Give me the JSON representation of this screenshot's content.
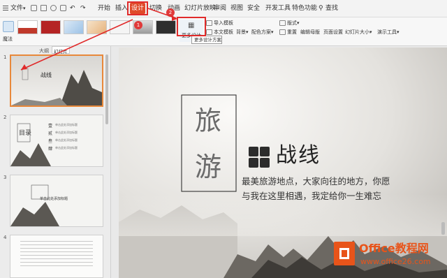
{
  "menubar": {
    "file_label": "文件",
    "tabs": [
      "开始",
      "插入",
      "设计",
      "切换",
      "动画",
      "幻灯片放映",
      "审阅",
      "视图",
      "安全",
      "开发工具",
      "特色功能"
    ],
    "search_label": "查找"
  },
  "ribbon": {
    "magic_label": "魔法",
    "more_designs_label": "更多设计",
    "import_template_label": "导入模板",
    "this_doc_template_label": "本文模板",
    "background_label": "背景",
    "color_scheme_label": "配色方案",
    "layout_label": "版式",
    "reset_label": "重置",
    "edit_master_label": "编辑母版",
    "page_setup_label": "页面设置",
    "slide_size_label": "幻灯片大小",
    "presentation_tools_label": "演示工具",
    "tooltip": "更多设计方案"
  },
  "sidepanel": {
    "tab_outline": "大纲",
    "tab_slides": "幻灯片",
    "slides": [
      {
        "num": "1",
        "title": "战线"
      },
      {
        "num": "2",
        "title": "目录"
      },
      {
        "num": "3",
        "title": "单击此处添加标题"
      },
      {
        "num": "4",
        "title": ""
      }
    ],
    "slide2_items": [
      "壹",
      "贰",
      "叁",
      "肆"
    ],
    "slide2_item_text": "单击此处添加标题"
  },
  "slide": {
    "big_title_top": "旅",
    "big_title_bottom": "游",
    "headline": "战线",
    "line1": "最美旅游地点，大家向往的地方，你愿",
    "line2": "与我在这里相遇，我定给你一生难忘"
  },
  "callouts": {
    "badge1": "1",
    "badge2": "2"
  },
  "watermark": {
    "brand": "Office教程网",
    "url": "www.office26.com"
  },
  "colors": {
    "accent_red": "#e02a2a",
    "wps_orange": "#e8541a",
    "tab_active_bg": "#e04a2a"
  }
}
